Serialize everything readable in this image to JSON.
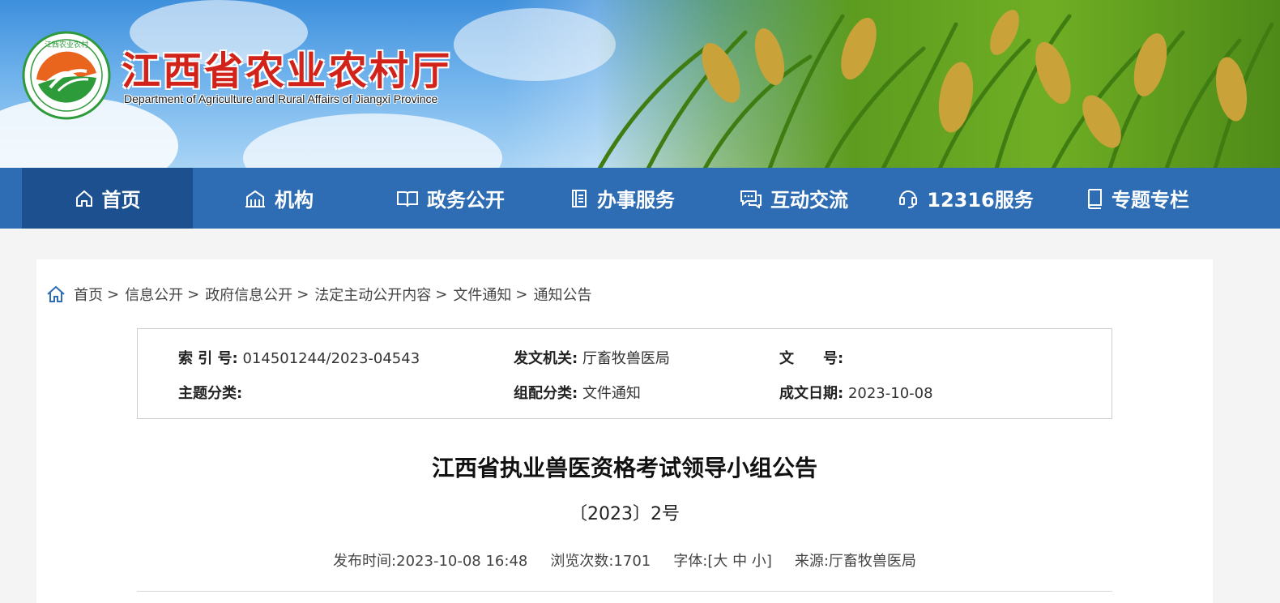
{
  "header": {
    "title": "江西省农业农村厅",
    "subtitle": "Department of Agriculture and Rural Affairs of Jiangxi Province",
    "logo_text": "江西农业农村"
  },
  "nav": {
    "items": [
      {
        "label": "首页",
        "icon": "home-icon",
        "active": true
      },
      {
        "label": "机构",
        "icon": "building-icon",
        "active": false
      },
      {
        "label": "政务公开",
        "icon": "open-book-icon",
        "active": false
      },
      {
        "label": "办事服务",
        "icon": "document-icon",
        "active": false
      },
      {
        "label": "互动交流",
        "icon": "chat-icon",
        "active": false
      },
      {
        "label": "12316服务",
        "icon": "headset-icon",
        "active": false
      },
      {
        "label": "专题专栏",
        "icon": "book-icon",
        "active": false
      }
    ]
  },
  "breadcrumb": {
    "items": [
      "首页",
      "信息公开",
      "政府信息公开",
      "法定主动公开内容",
      "文件通知",
      "通知公告"
    ],
    "separator": ">"
  },
  "meta": {
    "index_label": "索 引 号:",
    "index_value": "014501244/2023-04543",
    "issuer_label": "发文机关:",
    "issuer_value": "厅畜牧兽医局",
    "docno_label": "文　　号:",
    "docno_value": "",
    "topic_label": "主题分类:",
    "topic_value": "",
    "category_label": "组配分类:",
    "category_value": "文件通知",
    "date_label": "成文日期:",
    "date_value": "2023-10-08"
  },
  "article": {
    "title": "江西省执业兽医资格考试领导小组公告",
    "number": "〔2023〕2号",
    "publish_label": "发布时间:",
    "publish_time": "2023-10-08 16:48",
    "views_label": "浏览次数:",
    "views": "1701",
    "font_label": "字体:",
    "font_open": "[",
    "font_large": "大",
    "font_medium": "中",
    "font_small": "小",
    "font_close": "]",
    "source_label": "来源:",
    "source": "厅畜牧兽医局"
  },
  "colors": {
    "nav_bg": "#2e6db4",
    "nav_active": "#1c508f",
    "title_red": "#d1231a"
  }
}
